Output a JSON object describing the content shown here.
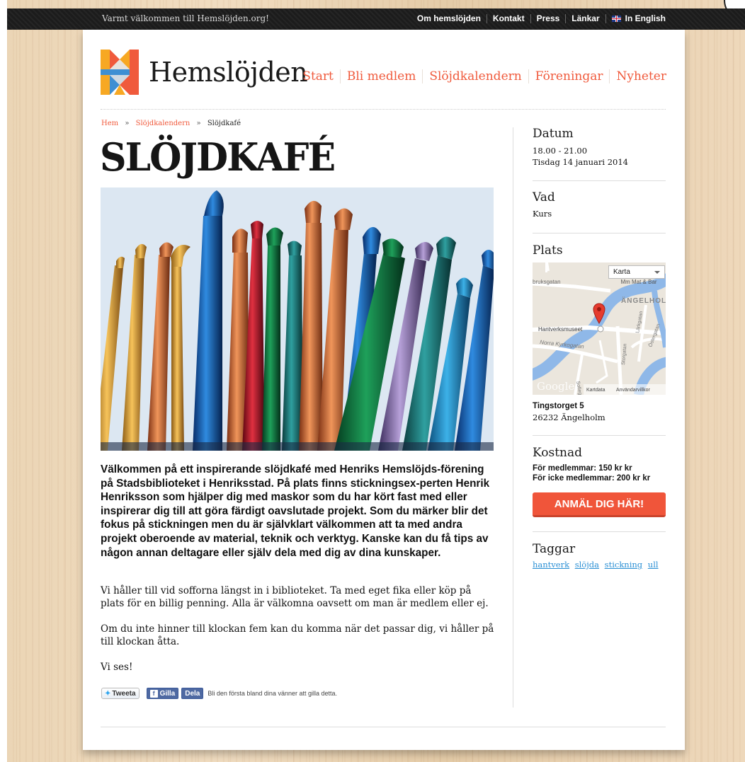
{
  "topbar": {
    "welcome": "Varmt välkommen till Hemslöjden.org!",
    "links": [
      "Om hemslöjden",
      "Kontakt",
      "Press",
      "Länkar"
    ],
    "english_label": "In English"
  },
  "header": {
    "logo_text": "Hemslöjden",
    "nav": [
      "Start",
      "Bli medlem",
      "Slöjdkalendern",
      "Föreningar",
      "Nyheter"
    ]
  },
  "breadcrumb": {
    "items": [
      "Hem",
      "Slöjdkalendern"
    ],
    "current": "Slöjdkafé",
    "separator": "»"
  },
  "article": {
    "title": "SLÖJDKAFÉ",
    "lead": "Välkommen på ett inspirerande slöjdkafé med Henriks Hemslöjds-förening på Stadsbiblioteket i Henriksstad. På plats finns stickningsex-perten Henrik Henriksson som hjälper dig med maskor som du har kört fast med eller inspirerar dig till att göra färdigt oavslutade projekt. Som du märker blir det fokus på stickningen men du är självklart välkommen att ta med andra projekt oberoende av material, teknik och verktyg. Kanske kan du få tips av någon annan deltagare eller själv dela med dig av dina kunskaper.",
    "paragraphs": [
      "Vi håller till vid sofforna längst in i biblioteket. Ta med eget fika eller köp på plats för en billig penning. Alla är välkomna oavsett om man är medlem eller ej.",
      "Om du inte hinner till klockan fem kan du komma när det passar dig, vi håller på till klockan åtta.",
      "Vi ses!"
    ]
  },
  "social": {
    "tweet": "Tweeta",
    "like": "Gilla",
    "share": "Dela",
    "fb_text": "Bli den första bland dina vänner att gilla detta."
  },
  "sidebar": {
    "datum": {
      "heading": "Datum",
      "time": "18.00 - 21.00",
      "date": "Tisdag 14 januari 2014"
    },
    "vad": {
      "heading": "Vad",
      "value": "Kurs"
    },
    "plats": {
      "heading": "Plats",
      "address": "Tingstorget 5",
      "city": "26232 Ängelholm",
      "map": {
        "type_select": "Karta",
        "labels": [
          "bruksgatan",
          "Mm Mat & Bar",
          "ÄNGELHOL",
          "Hantverksmuseet",
          "Norra Kyrkogatan",
          "Storgatan",
          "Lärkgatan",
          "Östergatan",
          "Sofiegatan"
        ],
        "google": "Google",
        "kartdata": "Kartdata",
        "terms": "Användarvillkor"
      }
    },
    "kostnad": {
      "heading": "Kostnad",
      "members": "För medlemmar: 150 kr kr",
      "nonmembers": "För icke medlemmar: 200 kr kr",
      "cta": "ANMÄL DIG HÄR!"
    },
    "taggar": {
      "heading": "Taggar",
      "tags": [
        "hantverk",
        "slöjda",
        "stickning",
        "ull"
      ]
    }
  },
  "colors": {
    "accent": "#f05a3c",
    "link_blue": "#2a8fd4",
    "topbar": "#1c1c1c"
  }
}
